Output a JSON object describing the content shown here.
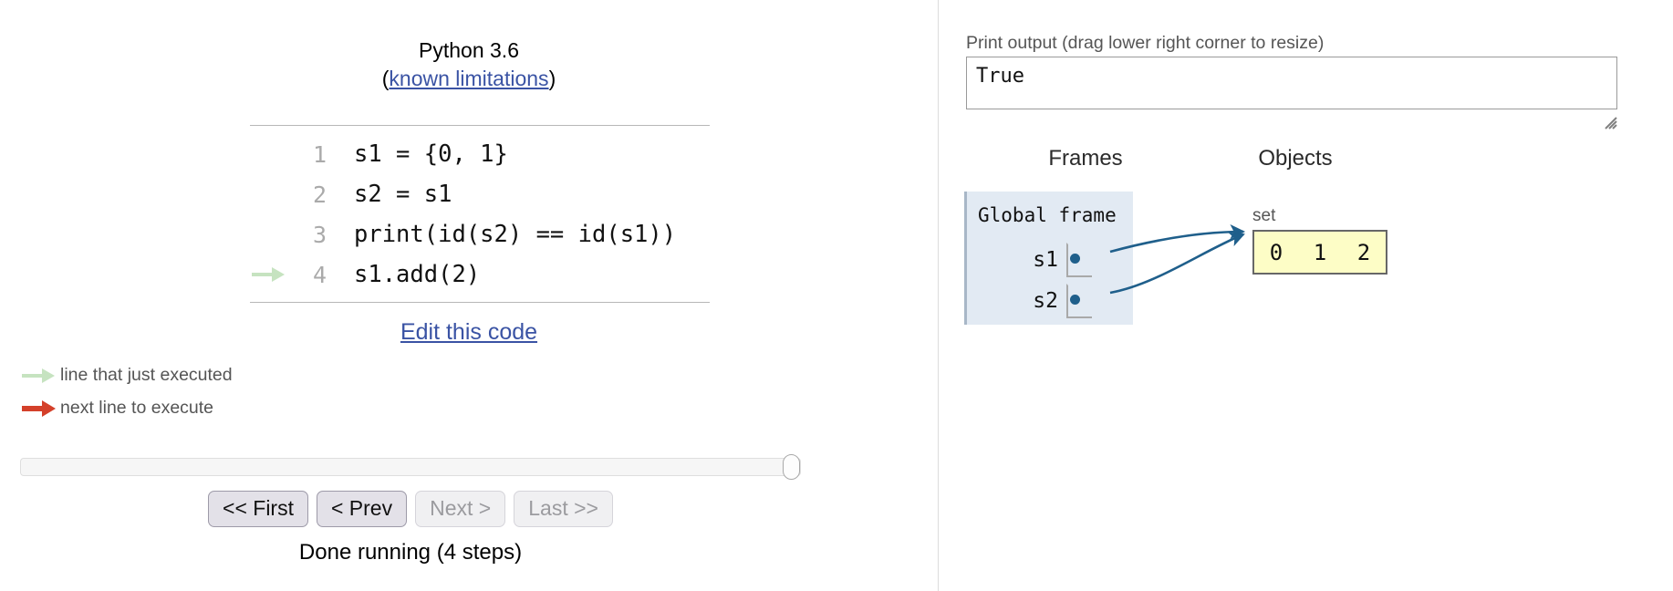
{
  "editor": {
    "python_version": "Python 3.6",
    "limitations_prefix": "(",
    "limitations_link": "known limitations",
    "limitations_suffix": ")",
    "edit_link": "Edit this code",
    "lines": [
      {
        "number": "1",
        "text": "s1 = {0, 1}",
        "arrow": "none"
      },
      {
        "number": "2",
        "text": "s2 = s1",
        "arrow": "none"
      },
      {
        "number": "3",
        "text": "print(id(s2) == id(s1))",
        "arrow": "none"
      },
      {
        "number": "4",
        "text": "s1.add(2)",
        "arrow": "green"
      }
    ]
  },
  "legend": {
    "rows": [
      {
        "icon": "green-arrow-icon",
        "label": "line that just executed",
        "color": "#c6e3c0"
      },
      {
        "icon": "red-arrow-icon",
        "label": "next line to execute",
        "color": "#d4402a"
      }
    ]
  },
  "controls": {
    "slider_position_percent": 100,
    "buttons": [
      {
        "label": "<< First",
        "enabled": true
      },
      {
        "label": "< Prev",
        "enabled": true
      },
      {
        "label": "Next >",
        "enabled": false
      },
      {
        "label": "Last >>",
        "enabled": false
      }
    ],
    "status": "Done running (4 steps)"
  },
  "output": {
    "label": "Print output (drag lower right corner to resize)",
    "value": "True"
  },
  "visualization": {
    "frames_heading": "Frames",
    "objects_heading": "Objects",
    "frame": {
      "title": "Global frame",
      "variables": [
        {
          "name": "s1",
          "points_to": "set-object"
        },
        {
          "name": "s2",
          "points_to": "set-object"
        }
      ]
    },
    "objects": [
      {
        "type_label": "set",
        "elements": [
          "0",
          "1",
          "2"
        ]
      }
    ]
  },
  "colors": {
    "link": "#3a53a4",
    "frame_bg": "#e2eaf3",
    "object_bg": "#fdfdc6",
    "pointer": "#1f5f8b",
    "just_executed": "#c6e3c0",
    "next_line": "#d4402a"
  }
}
